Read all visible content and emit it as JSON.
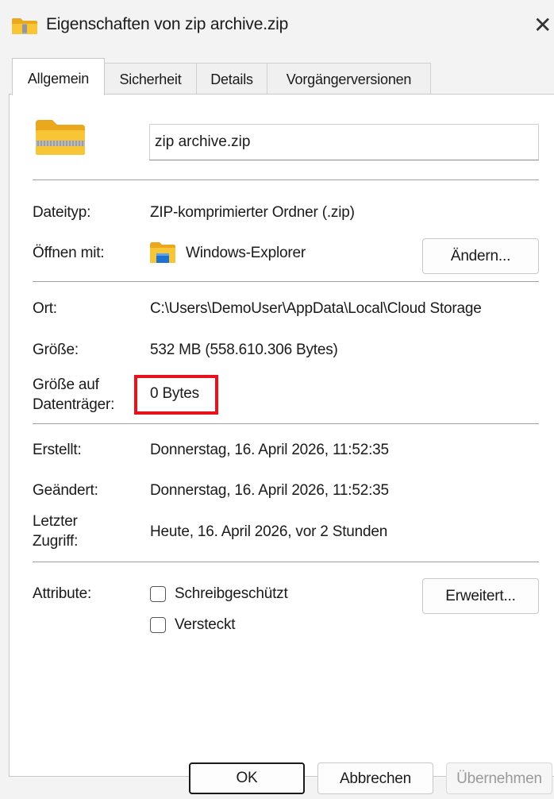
{
  "window": {
    "title": "Eigenschaften von zip archive.zip",
    "close_glyph": "✕"
  },
  "tabs": [
    {
      "label": "Allgemein",
      "active": true
    },
    {
      "label": "Sicherheit",
      "active": false
    },
    {
      "label": "Details",
      "active": false
    },
    {
      "label": "Vorgängerversionen",
      "active": false
    }
  ],
  "general": {
    "file_name": "zip archive.zip",
    "rows": {
      "type": {
        "label": "Dateityp:",
        "value": "ZIP-komprimierter Ordner (.zip)"
      },
      "open_with": {
        "label": "Öffnen mit:",
        "value": "Windows-Explorer",
        "button": "Ändern..."
      },
      "location": {
        "label": "Ort:",
        "value": "C:\\Users\\DemoUser\\AppData\\Local\\Cloud Storage"
      },
      "size": {
        "label": "Größe:",
        "value": "532 MB (558.610.306 Bytes)"
      },
      "size_on_disk": {
        "label_line1": "Größe auf",
        "label_line2": "Datenträger:",
        "value": "0 Bytes"
      },
      "created": {
        "label": "Erstellt:",
        "value": "Donnerstag, 16. April 2026, 11:52:35"
      },
      "modified": {
        "label": "Geändert:",
        "value": "Donnerstag, 16. April 2026, 11:52:35"
      },
      "accessed": {
        "label_line1": "Letzter",
        "label_line2": "Zugriff:",
        "value": "Heute, 16. April 2026, vor 2 Stunden"
      }
    },
    "attributes": {
      "label": "Attribute:",
      "readonly": {
        "label": "Schreibgeschützt",
        "checked": false
      },
      "hidden": {
        "label": "Versteckt",
        "checked": false
      },
      "advanced_button": "Erweitert..."
    }
  },
  "footer": {
    "ok": "OK",
    "cancel": "Abbrechen",
    "apply": "Übernehmen"
  },
  "colors": {
    "highlight": "#e8121c",
    "folder_yellow": "#f7c536",
    "explorer_blue": "#1e73d2"
  },
  "icons": {
    "title": "zip-folder-icon",
    "file": "zip-folder-icon",
    "open_with": "file-explorer-icon"
  }
}
